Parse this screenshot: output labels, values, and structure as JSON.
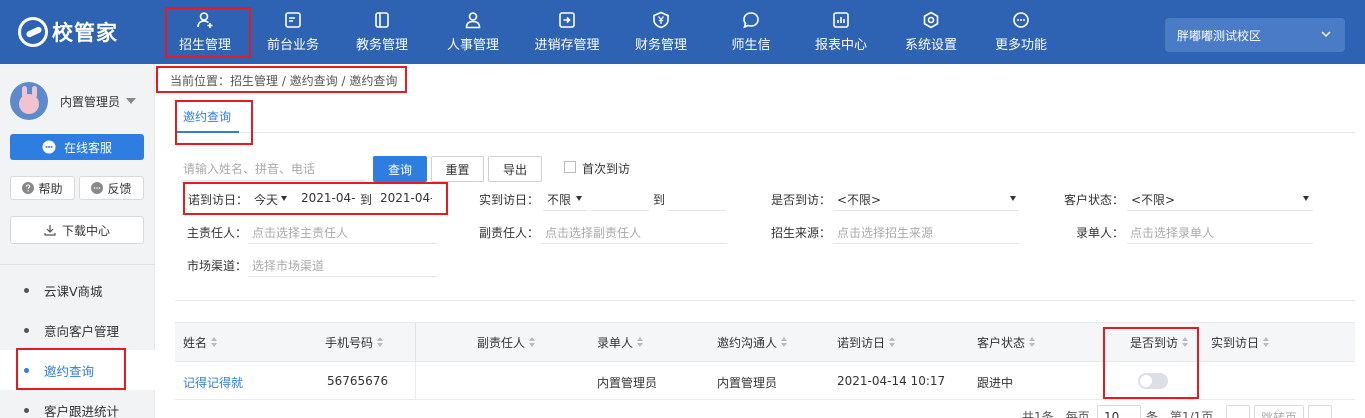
{
  "app": {
    "logo_text": "校管家"
  },
  "nav": [
    {
      "label": "招生管理",
      "icon": "user-add-icon"
    },
    {
      "label": "前台业务",
      "icon": "monitor-icon"
    },
    {
      "label": "教务管理",
      "icon": "book-icon"
    },
    {
      "label": "人事管理",
      "icon": "person-icon"
    },
    {
      "label": "进销存管理",
      "icon": "inventory-icon"
    },
    {
      "label": "财务管理",
      "icon": "yen-shield-icon"
    },
    {
      "label": "师生信",
      "icon": "message-icon"
    },
    {
      "label": "报表中心",
      "icon": "chart-icon"
    },
    {
      "label": "系统设置",
      "icon": "settings-icon"
    },
    {
      "label": "更多功能",
      "icon": "more-icon"
    }
  ],
  "campus": {
    "label": "胖嘟嘟测试校区"
  },
  "sidebar": {
    "user_name": "内置管理员",
    "service_button": "在线客服",
    "help_button": "帮助",
    "feedback_button": "反馈",
    "download_button": "下载中心",
    "menu": [
      {
        "label": "云课V商城",
        "active": false
      },
      {
        "label": "意向客户管理",
        "active": false
      },
      {
        "label": "邀约查询",
        "active": true
      },
      {
        "label": "客户跟进统计",
        "active": false
      }
    ]
  },
  "breadcrumb": "当前位置：招生管理 / 邀约查询 / 邀约查询",
  "tab": {
    "label": "邀约查询"
  },
  "search": {
    "placeholder": "请输入姓名、拼音、电话",
    "query_button": "查询",
    "reset_button": "重置",
    "export_button": "导出",
    "first_visit_label": "首次到访"
  },
  "filters": {
    "promised_visit_label": "诺到访日：",
    "promised_visit_range": "今天",
    "promised_visit_start": "2021-04-",
    "to_label": "到",
    "promised_visit_end": "2021-04-",
    "actual_visit_label": "实到访日：",
    "actual_visit_range": "不限",
    "actual_to_label": "到",
    "visited_label": "是否到访：",
    "visited_value": "<不限>",
    "customer_status_label": "客户状态：",
    "customer_status_value": "<不限>",
    "owner_label": "主责任人：",
    "owner_placeholder": "点击选择主责任人",
    "deputy_label": "副责任人：",
    "deputy_placeholder": "点击选择副责任人",
    "source_label": "招生来源：",
    "source_placeholder": "点击选择招生来源",
    "recorder_label": "录单人：",
    "recorder_placeholder": "点击选择录单人",
    "channel_label": "市场渠道：",
    "channel_placeholder": "选择市场渠道"
  },
  "table": {
    "columns": [
      "姓名",
      "手机号码",
      "副责任人",
      "录单人",
      "邀约沟通人",
      "诺到访日",
      "客户状态",
      "是否到访",
      "实到访日"
    ],
    "rows": [
      {
        "name": "记得记得就",
        "phone": "56765676",
        "deputy": "",
        "recorder": "内置管理员",
        "inviter": "内置管理员",
        "promised_date": "2021-04-14 10:17",
        "status": "跟进中",
        "visited": false,
        "actual_date": ""
      }
    ]
  },
  "pager": {
    "total_text": "共1条，每页",
    "page_size": "10",
    "unit_text": "条，第1/1页",
    "jump_label": "跳转页"
  }
}
